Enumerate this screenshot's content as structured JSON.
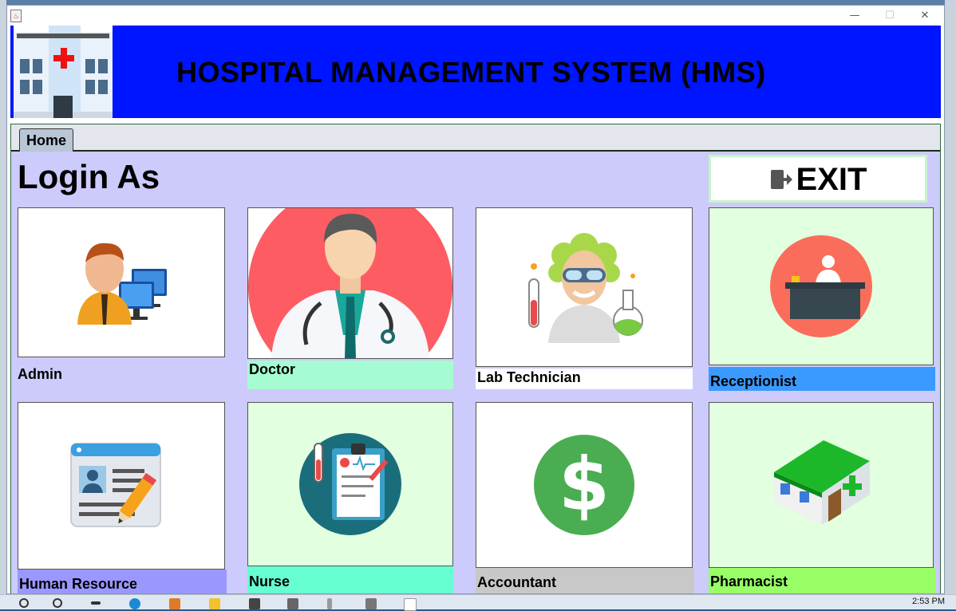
{
  "window": {
    "minimize_label": "—",
    "maximize_label": "☐",
    "close_label": "✕"
  },
  "header": {
    "title": "HOSPITAL MANAGEMENT SYSTEM (HMS)"
  },
  "tabs": [
    {
      "label": "Home",
      "selected": true
    }
  ],
  "main": {
    "heading": "Login As",
    "exit_label": "EXIT",
    "roles": [
      {
        "label": "Admin",
        "icon": "admin-icon"
      },
      {
        "label": "Doctor",
        "icon": "doctor-icon"
      },
      {
        "label": "Lab Technician",
        "icon": "lab-technician-icon"
      },
      {
        "label": "Receptionist",
        "icon": "receptionist-icon"
      },
      {
        "label": "Human Resource",
        "icon": "id-card-icon"
      },
      {
        "label": "Nurse",
        "icon": "clipboard-icon"
      },
      {
        "label": "Accountant",
        "icon": "dollar-icon"
      },
      {
        "label": "Pharmacist",
        "icon": "pharmacy-icon"
      }
    ]
  },
  "taskbar": {
    "time": "2:53 PM"
  },
  "colors": {
    "header_bg": "#0015ff",
    "panel_bg": "#cccbfb",
    "doctor_caption": "#a6fcd2",
    "receptionist_caption": "#3a9aff",
    "hr_caption": "#9a98ff",
    "nurse_caption": "#66ffd2",
    "accountant_caption": "#c8c8c8",
    "pharmacist_caption": "#99ff66"
  }
}
